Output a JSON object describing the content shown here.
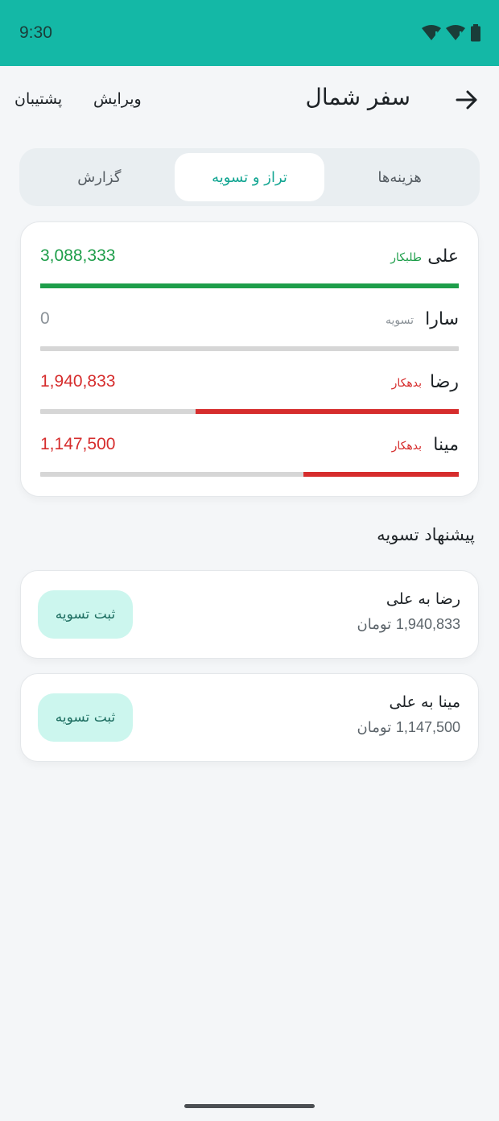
{
  "status": {
    "time": "9:30"
  },
  "header": {
    "title": "سفر شمال",
    "edit_label": "ویرایش",
    "support_label": "پشتیبان"
  },
  "tabs": [
    {
      "label": "هزینه‌ها",
      "active": false
    },
    {
      "label": "تراز و تسویه",
      "active": true
    },
    {
      "label": "گزارش",
      "active": false
    }
  ],
  "balances": [
    {
      "name": "علی",
      "status": "طلبکار",
      "amount": "3,088,333",
      "share": 1.0,
      "color": "#1e9e4a"
    },
    {
      "name": "سارا",
      "status": "تسویه",
      "amount": "0",
      "share": 0.0,
      "color": "#8a9197"
    },
    {
      "name": "رضا",
      "status": "بدهکار",
      "amount": "1,940,833",
      "share": 0.628,
      "color": "#d62d2d"
    },
    {
      "name": "مینا",
      "status": "بدهکار",
      "amount": "1,147,500",
      "share": 0.372,
      "color": "#d62d2d"
    }
  ],
  "settlement": {
    "title": "پیشنهاد تسویه",
    "items": [
      {
        "title": "رضا به علی",
        "amount": "1,940,833",
        "currency": "تومان",
        "button": "ثبت تسویه"
      },
      {
        "title": "مینا به علی",
        "amount": "1,147,500",
        "currency": "تومان",
        "button": "ثبت تسویه"
      }
    ]
  },
  "colors": {
    "accent": "#14b8a6",
    "positive": "#1e9e4a",
    "negative": "#d62d2d"
  }
}
